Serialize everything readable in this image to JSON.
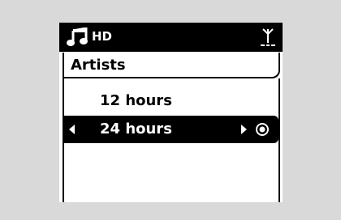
{
  "status_bar": {
    "source_label": "HD",
    "music_icon": "music-note-icon",
    "antenna_icon": "antenna-signal-icon"
  },
  "header": {
    "title": "Artists"
  },
  "list": {
    "items": [
      {
        "label": "12 hours",
        "selected": false
      },
      {
        "label": "24 hours",
        "selected": true
      }
    ]
  },
  "colors": {
    "background": "#d9d9d9",
    "screen": "#ffffff",
    "highlight": "#000000",
    "highlight_text": "#ffffff"
  }
}
